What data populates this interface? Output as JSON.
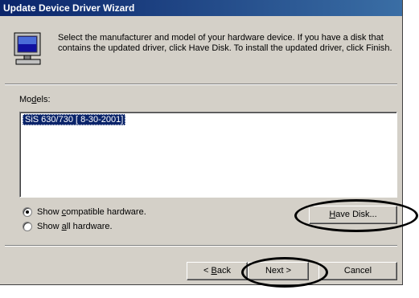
{
  "window": {
    "title": "Update Device Driver Wizard"
  },
  "header": {
    "icon": "monitor-icon",
    "instructions": "Select the manufacturer and model of your hardware device. If you have a disk that contains the updated driver, click Have Disk. To install the updated driver, click Finish."
  },
  "models": {
    "label_pre": "Mo",
    "label_accel": "d",
    "label_post": "els:",
    "items": [
      "SiS 630/730 [ 8-30-2001]"
    ]
  },
  "options": {
    "compatible": {
      "pre": "Show ",
      "accel": "c",
      "post": "ompatible hardware.",
      "selected": true
    },
    "all": {
      "pre": "Show ",
      "accel": "a",
      "post": "ll hardware.",
      "selected": false
    }
  },
  "buttons": {
    "have_disk": {
      "accel": "H",
      "rest": "ave Disk..."
    },
    "back": {
      "pre": "< ",
      "accel": "B",
      "rest": "ack"
    },
    "next": "Next >",
    "cancel": "Cancel"
  }
}
